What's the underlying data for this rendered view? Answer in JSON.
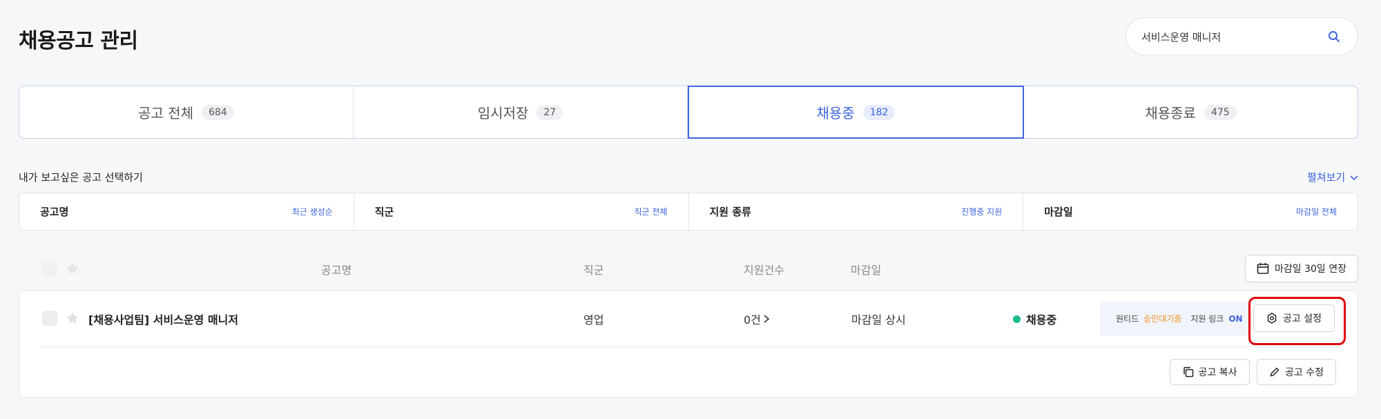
{
  "header": {
    "title": "채용공고 관리"
  },
  "search": {
    "value": "서비스운영 매니저",
    "icon": "search-icon"
  },
  "tabs": [
    {
      "label": "공고 전체",
      "count": "684"
    },
    {
      "label": "임시저장",
      "count": "27"
    },
    {
      "label": "채용중",
      "count": "182",
      "active": true
    },
    {
      "label": "채용종료",
      "count": "475"
    }
  ],
  "filter_section": {
    "title": "내가 보고싶은 공고 선택하기",
    "expand_label": "펼쳐보기"
  },
  "filters": [
    {
      "label": "공고명",
      "value": "최근 생성순"
    },
    {
      "label": "직군",
      "value": "직군 전체"
    },
    {
      "label": "지원 종류",
      "value": "진행중 지원"
    },
    {
      "label": "마감일",
      "value": "마감일 전체"
    }
  ],
  "columns": {
    "title": "공고명",
    "job_group": "직군",
    "applicants": "지원건수",
    "deadline": "마감일"
  },
  "extend_button": {
    "label": "마감일 30일 연장"
  },
  "jobs": [
    {
      "title": "[채용사업팀] 서비스운영 매니저",
      "job_group": "영업",
      "applicants": "0건",
      "deadline": "마감일 상시",
      "status": "채용중",
      "info": {
        "wanted_label": "원티드",
        "wanted_status": "승인대기중",
        "link_label": "지원 링크",
        "link_status": "ON"
      },
      "settings_label": "공고 설정",
      "copy_label": "공고 복사",
      "edit_label": "공고 수정"
    }
  ],
  "colors": {
    "accent": "#3d63dd",
    "status_green": "#1bb98e",
    "pending_orange": "#f08a1c",
    "highlight_red": "#e0000a"
  }
}
